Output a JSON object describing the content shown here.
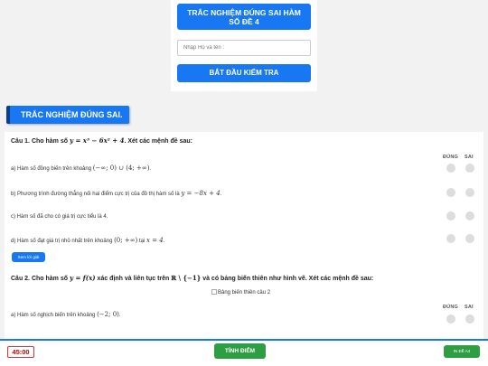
{
  "header": {
    "title_line1": "TRẮC NGHIỆM ĐÚNG SAI HÀM",
    "title_line2": "SỐ ĐỀ 4",
    "name_placeholder": "Nhập Họ và tên :",
    "start_label": "BẮT ĐẦU KIỂM TRA"
  },
  "section": {
    "heading": "TRẮC NGHIỆM ĐÚNG SAI."
  },
  "columns": {
    "true_label": "ĐÚNG",
    "false_label": "SAI"
  },
  "q1": {
    "pre": "Câu 1. Cho hàm số",
    "formula": "y = x³ − 6x² + 4",
    "post": ". Xét các mệnh đề sau:",
    "a_text": "a) Hàm số đồng biến trên khoảng",
    "a_math": "(−∞; 0) ∪ (4; +∞)",
    "a_end": ".",
    "b_text": "b) Phương trình đường thẳng nối hai điểm cực trị của đồ thị hàm số là",
    "b_math": "y = −8x + 4",
    "b_end": ".",
    "c_text": "c) Hàm số đã cho có giá trị cực tiểu là 4.",
    "d_text": "d) Hàm số đạt giá trị nhỏ nhất trên khoảng",
    "d_math1": "(0; +∞)",
    "d_mid": "tại",
    "d_math2": "x = 4",
    "d_end": ".",
    "solution_label": "Xem lời giải"
  },
  "q2": {
    "pre": "Câu 2. Cho hàm số",
    "formula": "y = f(x)",
    "mid": "xác định và liên tục trên",
    "domain": "ℝ \\ {−1}",
    "post": "và có bảng biến thiên như hình vẽ. Xét các mệnh đề sau:",
    "image_alt": "Bảng biến thiên câu 2",
    "a_text": "a) Hàm số nghịch biến trên khoảng",
    "a_math": "(−2; 0)",
    "a_end": "."
  },
  "footer": {
    "timer": "45:00",
    "score_label": "TÍNH ĐIỂM",
    "print_label": "IN ĐỀ A4"
  }
}
